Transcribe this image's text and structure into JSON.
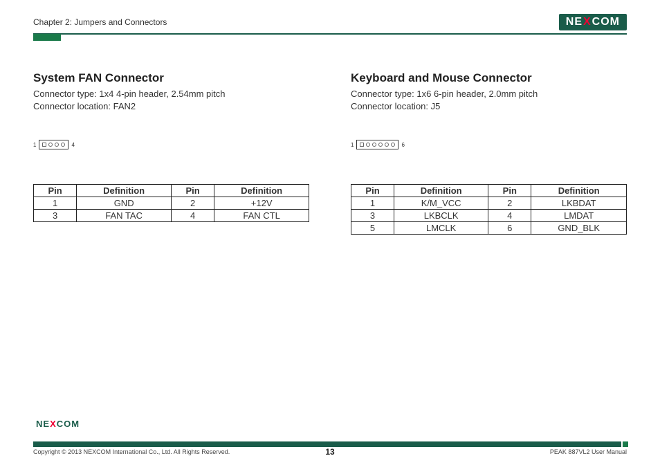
{
  "header": {
    "chapter": "Chapter 2: Jumpers and Connectors",
    "logo_pre": "NE",
    "logo_x": "X",
    "logo_post": "COM"
  },
  "left": {
    "title": "System FAN Connector",
    "line1": "Connector type: 1x4 4-pin header, 2.54mm pitch",
    "line2": "Connector location: FAN2",
    "diag_start": "1",
    "diag_end": "4",
    "table": {
      "h_pin": "Pin",
      "h_def": "Definition",
      "rows": [
        {
          "p1": "1",
          "d1": "GND",
          "p2": "2",
          "d2": "+12V"
        },
        {
          "p1": "3",
          "d1": "FAN TAC",
          "p2": "4",
          "d2": "FAN CTL"
        }
      ]
    }
  },
  "right": {
    "title": "Keyboard and Mouse Connector",
    "line1": "Connector type: 1x6 6-pin header, 2.0mm pitch",
    "line2": "Connector location: J5",
    "diag_start": "1",
    "diag_end": "6",
    "table": {
      "h_pin": "Pin",
      "h_def": "Definition",
      "rows": [
        {
          "p1": "1",
          "d1": "K/M_VCC",
          "p2": "2",
          "d2": "LKBDAT"
        },
        {
          "p1": "3",
          "d1": "LKBCLK",
          "p2": "4",
          "d2": "LMDAT"
        },
        {
          "p1": "5",
          "d1": "LMCLK",
          "p2": "6",
          "d2": "GND_BLK"
        }
      ]
    }
  },
  "footer": {
    "copyright": "Copyright © 2013 NEXCOM International Co., Ltd. All Rights Reserved.",
    "page": "13",
    "manual": "PEAK 887VL2 User Manual"
  }
}
